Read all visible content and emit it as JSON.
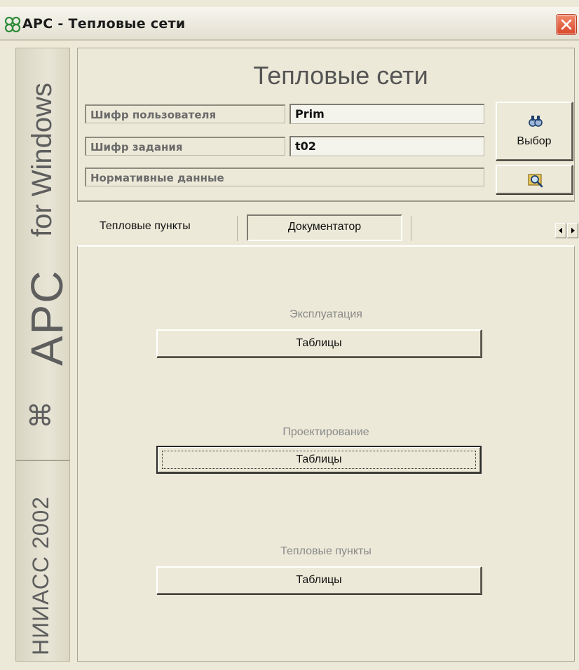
{
  "window": {
    "title_app": "APC",
    "title_sep": " - ",
    "title_name": "Тепловые сети",
    "app_icon": "apc-cloverleaf-icon",
    "close_icon": "close-icon"
  },
  "side": {
    "for_windows": "for Windows",
    "apc": "APC",
    "symbol": "⌘",
    "org": "НИИАСС 2002"
  },
  "header": {
    "title": "Тепловые сети",
    "fields": [
      {
        "label": "Шифр пользователя",
        "value": "Prim"
      },
      {
        "label": "Шифр задания",
        "value": "t02"
      }
    ],
    "normative_label": "Нормативные данные",
    "select_button": "Выбор",
    "select_icon": "binoculars-icon",
    "browse_icon": "magnifier-folder-icon"
  },
  "tabs": {
    "items": [
      "Тепловые пункты",
      "Документатор"
    ],
    "active": "Документатор",
    "scroll_left_icon": "arrow-left-icon",
    "scroll_right_icon": "arrow-right-icon"
  },
  "content": {
    "sections": [
      {
        "label": "Эксплуатация",
        "button": "Таблицы"
      },
      {
        "label": "Проектирование",
        "button": "Таблицы"
      },
      {
        "label": "Тепловые пункты",
        "button": "Таблицы"
      }
    ]
  },
  "colors": {
    "window_bg": "#ece9d8",
    "close_button": "#d9472b",
    "muted_text": "#8a8a8a"
  }
}
